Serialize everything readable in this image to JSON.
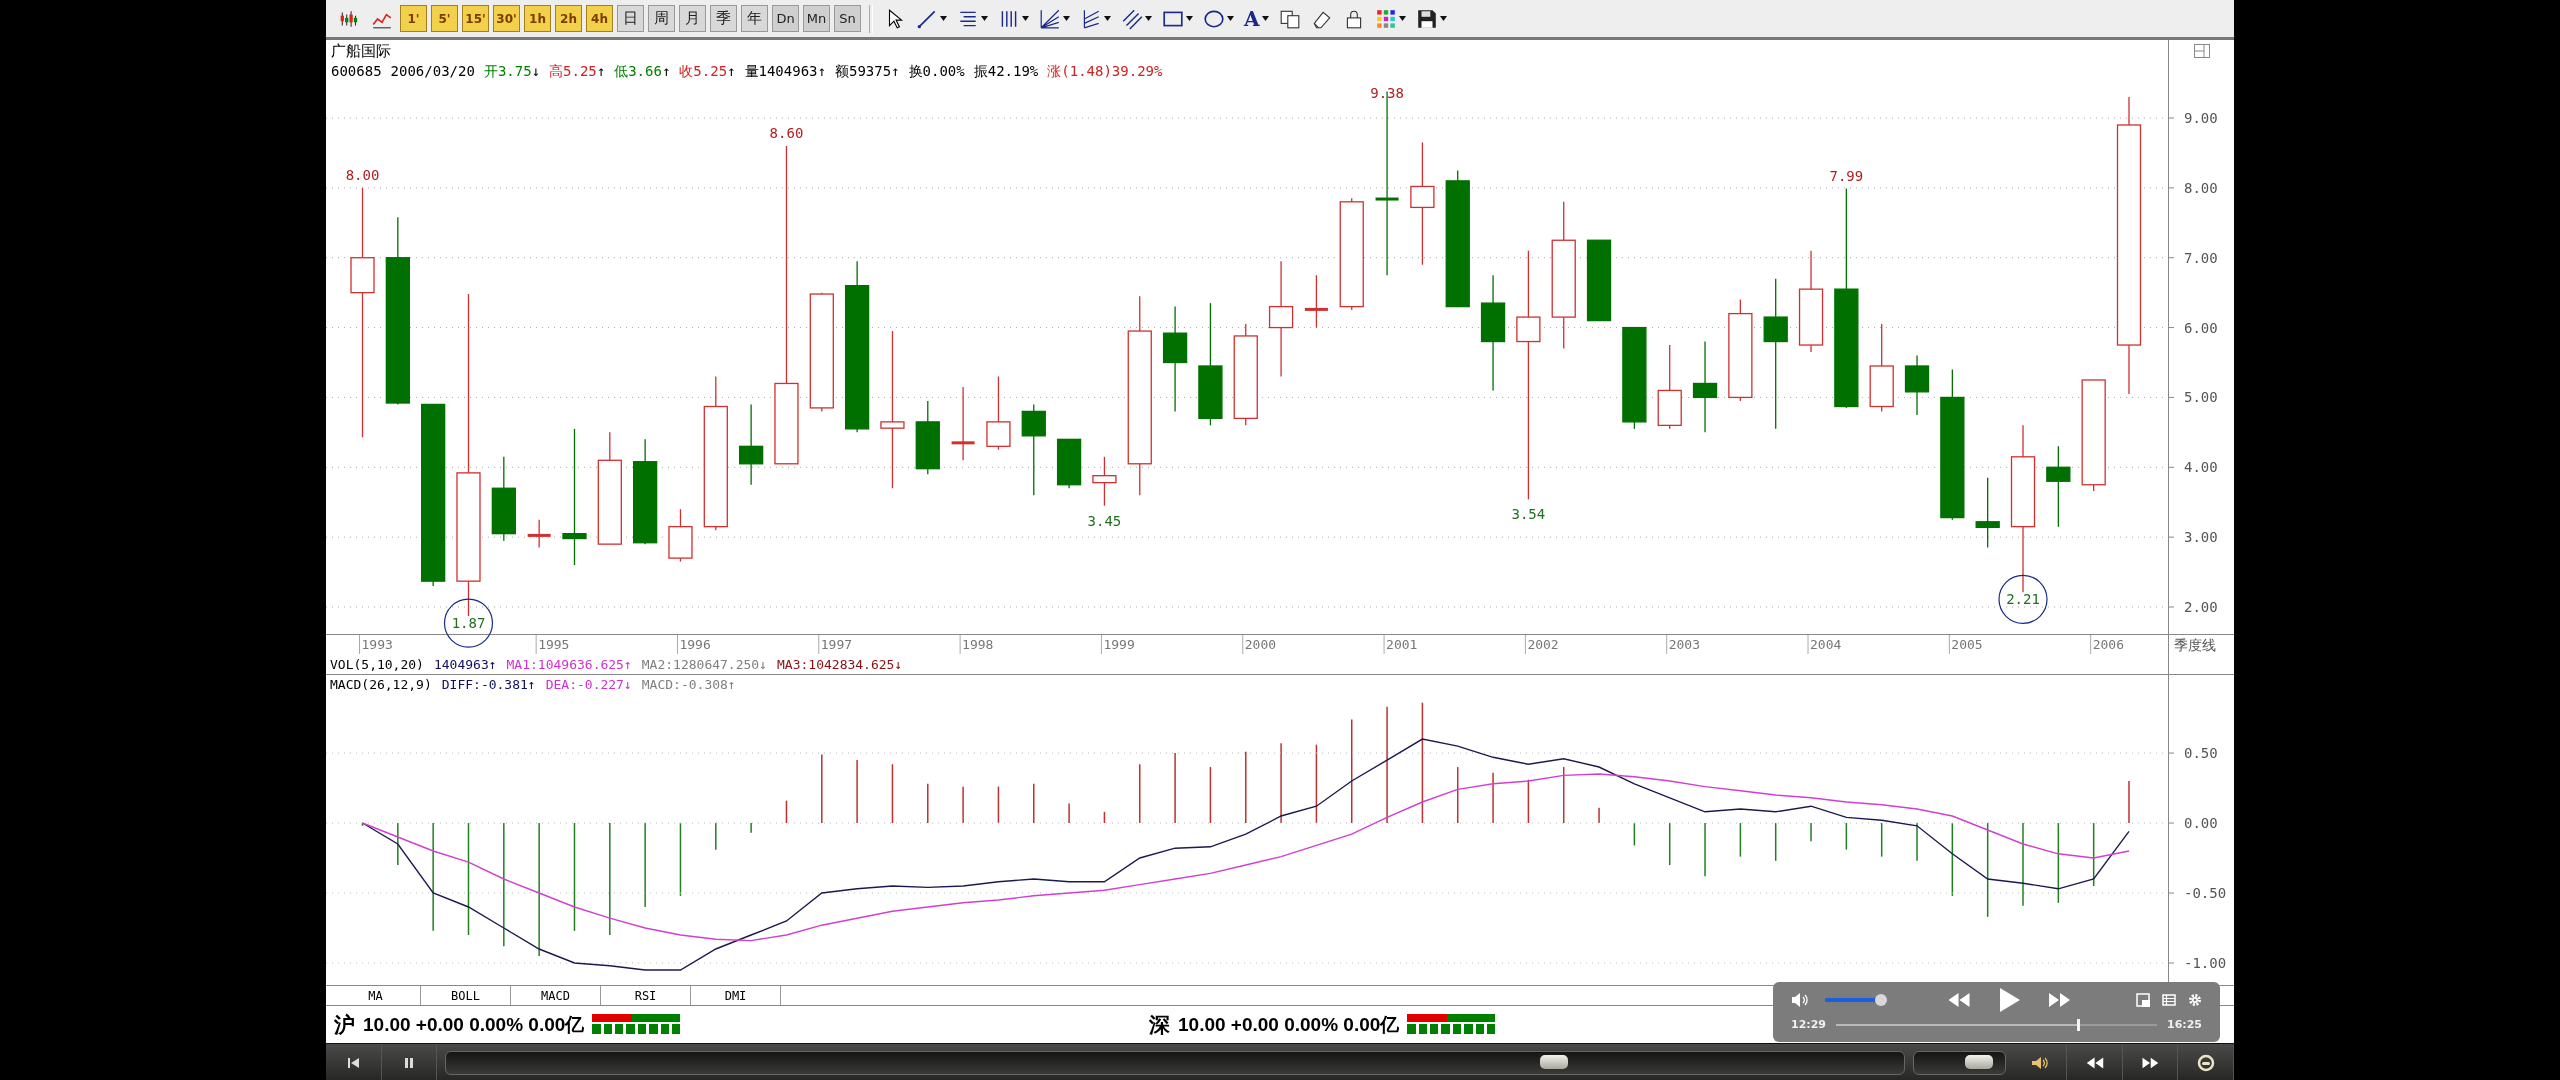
{
  "toolbar": {
    "chart_buttons": [
      {
        "kind": "candlestick"
      },
      {
        "kind": "line-chart"
      }
    ],
    "period_buttons": [
      {
        "label": "1'",
        "kind": "intraday"
      },
      {
        "label": "5'",
        "kind": "intraday"
      },
      {
        "label": "15'",
        "kind": "intraday"
      },
      {
        "label": "30'",
        "kind": "intraday"
      },
      {
        "label": "1h",
        "kind": "intraday"
      },
      {
        "label": "2h",
        "kind": "intraday"
      },
      {
        "label": "4h",
        "kind": "intraday"
      },
      {
        "label": "日",
        "kind": "calendar"
      },
      {
        "label": "周",
        "kind": "calendar"
      },
      {
        "label": "月",
        "kind": "calendar"
      },
      {
        "label": "季",
        "kind": "calendar"
      },
      {
        "label": "年",
        "kind": "calendar"
      },
      {
        "label": "Dn",
        "kind": "multi"
      },
      {
        "label": "Mn",
        "kind": "multi"
      },
      {
        "label": "Sn",
        "kind": "multi"
      }
    ],
    "tools": [
      {
        "kind": "pointer",
        "dropdown": false
      },
      {
        "kind": "diagonal-line",
        "dropdown": true
      },
      {
        "kind": "horizontal-lines",
        "dropdown": true
      },
      {
        "kind": "vertical-lines",
        "dropdown": true
      },
      {
        "kind": "fan-lines",
        "dropdown": true
      },
      {
        "kind": "angle-lines",
        "dropdown": true
      },
      {
        "kind": "parallel-lines",
        "dropdown": true
      },
      {
        "kind": "rectangle",
        "dropdown": true
      },
      {
        "kind": "ellipse",
        "dropdown": true
      },
      {
        "kind": "letter",
        "glyph": "A",
        "dropdown": true
      },
      {
        "kind": "copy",
        "dropdown": false
      },
      {
        "kind": "eraser",
        "dropdown": false
      },
      {
        "kind": "lock",
        "dropdown": false
      },
      {
        "kind": "color-grid",
        "dropdown": true
      },
      {
        "kind": "floppy-disk",
        "dropdown": true
      }
    ]
  },
  "chart": {
    "title": "广船国际",
    "info": [
      {
        "text": "600685",
        "color": "#000000"
      },
      {
        "text": "2006/03/20",
        "color": "#000000"
      },
      {
        "label": "开",
        "text": "3.75",
        "arrow": "↓",
        "color": "#008000"
      },
      {
        "label": "高",
        "text": "5.25",
        "arrow": "↑",
        "color": "#d02020"
      },
      {
        "label": "低",
        "text": "3.66",
        "arrow": "↑",
        "color": "#008000"
      },
      {
        "label": "收",
        "text": "5.25",
        "arrow": "↑",
        "color": "#d02020"
      },
      {
        "label": "量",
        "text": "1404963",
        "arrow": "↑",
        "color": "#000000"
      },
      {
        "label": "额",
        "text": "59375",
        "arrow": "↑",
        "color": "#000000"
      },
      {
        "label": "换",
        "text": "0.00%",
        "color": "#000000"
      },
      {
        "label": "振",
        "text": "42.19%",
        "color": "#000000"
      },
      {
        "label": "涨",
        "text": "(1.48)39.29%",
        "color": "#d02020"
      }
    ],
    "period_label": "季度线",
    "price": {
      "axis_labels": [
        "9.00",
        "8.00",
        "7.00",
        "6.00",
        "5.00",
        "4.00",
        "3.00",
        "2.00"
      ],
      "year_labels": [
        "1993",
        "1995",
        "1996",
        "1997",
        "1998",
        "1999",
        "2000",
        "2001",
        "2002",
        "2003",
        "2004",
        "2005",
        "2006"
      ],
      "marks": [
        {
          "text": "8.00"
        },
        {
          "text": "8.60"
        },
        {
          "text": "9.38"
        },
        {
          "text": "7.99"
        },
        {
          "text": "3.45"
        },
        {
          "text": "3.54"
        },
        {
          "text": "1.87"
        },
        {
          "text": "2.21"
        }
      ]
    },
    "volume_legend": [
      {
        "text": "VOL(5,10,20)",
        "color": "#000000"
      },
      {
        "text": "1404963↑",
        "color": "#101060"
      },
      {
        "text": "MA1:1049636.625↑",
        "color": "#d030d0"
      },
      {
        "text": "MA2:1280647.250↓",
        "color": "#808080"
      },
      {
        "text": "MA3:1042834.625↓",
        "color": "#8b1010"
      }
    ],
    "macd_legend": [
      {
        "text": "MACD(26,12,9)",
        "color": "#000000"
      },
      {
        "text": "DIFF:-0.381↑",
        "color": "#101060"
      },
      {
        "text": "DEA:-0.227↓",
        "color": "#d030d0"
      },
      {
        "text": "MACD:-0.308↑",
        "color": "#808080"
      }
    ],
    "macd": {
      "chart_data": {
        "type": "line",
        "grid": true,
        "categories": [
          null,
          null,
          null,
          null,
          null,
          null,
          null,
          null,
          null,
          null,
          null,
          null,
          null,
          null,
          null,
          null,
          null,
          null,
          null,
          null,
          null,
          null,
          null,
          null,
          null,
          null,
          null,
          null,
          null,
          null,
          null,
          null,
          null,
          null,
          null,
          null,
          null,
          null,
          null,
          null,
          null,
          null,
          null,
          null,
          null,
          null,
          null,
          null,
          null,
          null,
          null
        ],
        "series": [
          {
            "color": "#1a1a50",
            "values": [
              0,
              -0.15,
              -0.5,
              -0.6,
              -0.75,
              -0.9,
              -1.0,
              -1.02,
              -1.05,
              -1.05,
              -0.9,
              -0.8,
              -0.7,
              -0.5,
              -0.47,
              -0.45,
              -0.46,
              -0.45,
              -0.42,
              -0.4,
              -0.42,
              -0.42,
              -0.25,
              -0.18,
              -0.17,
              -0.08,
              0.05,
              0.12,
              0.3,
              0.45,
              0.6,
              0.55,
              0.47,
              0.42,
              0.46,
              0.4,
              0.28,
              0.18,
              0.08,
              0.1,
              0.08,
              0.12,
              0.04,
              0.02,
              -0.02,
              -0.22,
              -0.4,
              -0.43,
              -0.47,
              -0.4,
              -0.06
            ]
          },
          {
            "color": "#d040d0",
            "values": [
              0,
              -0.1,
              -0.2,
              -0.28,
              -0.4,
              -0.5,
              -0.6,
              -0.68,
              -0.75,
              -0.8,
              -0.83,
              -0.84,
              -0.8,
              -0.73,
              -0.68,
              -0.63,
              -0.6,
              -0.57,
              -0.55,
              -0.52,
              -0.5,
              -0.48,
              -0.44,
              -0.4,
              -0.36,
              -0.3,
              -0.24,
              -0.16,
              -0.08,
              0.04,
              0.15,
              0.24,
              0.28,
              0.3,
              0.34,
              0.35,
              0.33,
              0.3,
              0.26,
              0.23,
              0.2,
              0.18,
              0.15,
              0.13,
              0.1,
              0.05,
              -0.05,
              -0.15,
              -0.22,
              -0.25,
              -0.2
            ]
          }
        ],
        "ylim": [
          -1.157,
          0.929
        ],
        "yticks": [
          {
            "value": 0.5,
            "label": "0.50"
          },
          {
            "value": 0,
            "label": "0.00"
          },
          {
            "value": -0.5,
            "label": "-0.50"
          },
          {
            "value": -1,
            "label": "-1.00"
          }
        ]
      }
    }
  },
  "indicator_tabs": [
    {
      "label": "MA",
      "selected": false
    },
    {
      "label": "BOLL",
      "selected": false
    },
    {
      "label": "MACD",
      "selected": false
    },
    {
      "label": "RSI",
      "selected": false
    },
    {
      "label": "DMI",
      "selected": false
    }
  ],
  "status_bar": {
    "markets": [
      {
        "name": "沪",
        "quote": "10.00 +0.00 0.00% 0.00亿",
        "level": 0.45
      },
      {
        "name": "深",
        "quote": "10.00 +0.00 0.00% 0.00亿",
        "level": 0.45
      }
    ]
  },
  "video_overlay": {
    "volume": {
      "level": 1.0
    },
    "controls": [
      {
        "kind": "rewind"
      },
      {
        "kind": "play"
      },
      {
        "kind": "fast-forward"
      }
    ],
    "extras": [
      {
        "kind": "picture-in-picture"
      },
      {
        "kind": "list"
      },
      {
        "kind": "settings"
      }
    ],
    "elapsed": "12:29",
    "duration": "16:25",
    "progress": {
      "level": 0.754
    }
  },
  "player_bar": {
    "left_buttons": [
      {
        "kind": "skip-back"
      },
      {
        "kind": "pause"
      }
    ],
    "seek": {
      "level": 0.76
    },
    "volume": {
      "level": 0.72
    },
    "right_buttons": [
      {
        "kind": "speaker"
      },
      {
        "kind": "rewind"
      },
      {
        "kind": "fast-forward"
      },
      {
        "kind": "record"
      }
    ]
  }
}
